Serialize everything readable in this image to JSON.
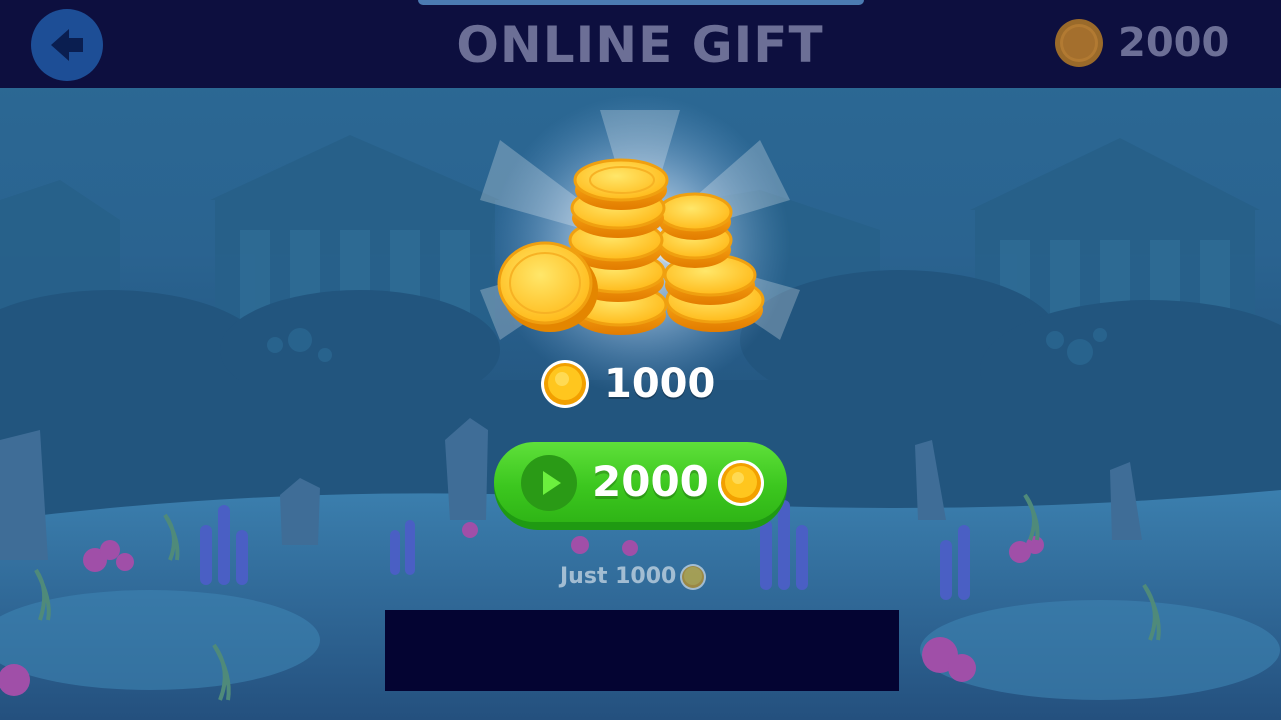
{
  "header": {
    "title": "ONLINE GIFT",
    "balance": "2000",
    "back_icon": "arrow-left-icon",
    "coin_icon": "coin-icon"
  },
  "reward": {
    "amount": "1000",
    "image": "coin-pile"
  },
  "claim_button": {
    "label": "2000",
    "icon": "play-icon"
  },
  "note": {
    "text": "Just 1000"
  },
  "colors": {
    "header_bg": "#0d0f3f",
    "title": "#6c6f96",
    "button_green": "#3cc71f",
    "coin_gold": "#ffc21a",
    "ad_banner": "#040432"
  }
}
